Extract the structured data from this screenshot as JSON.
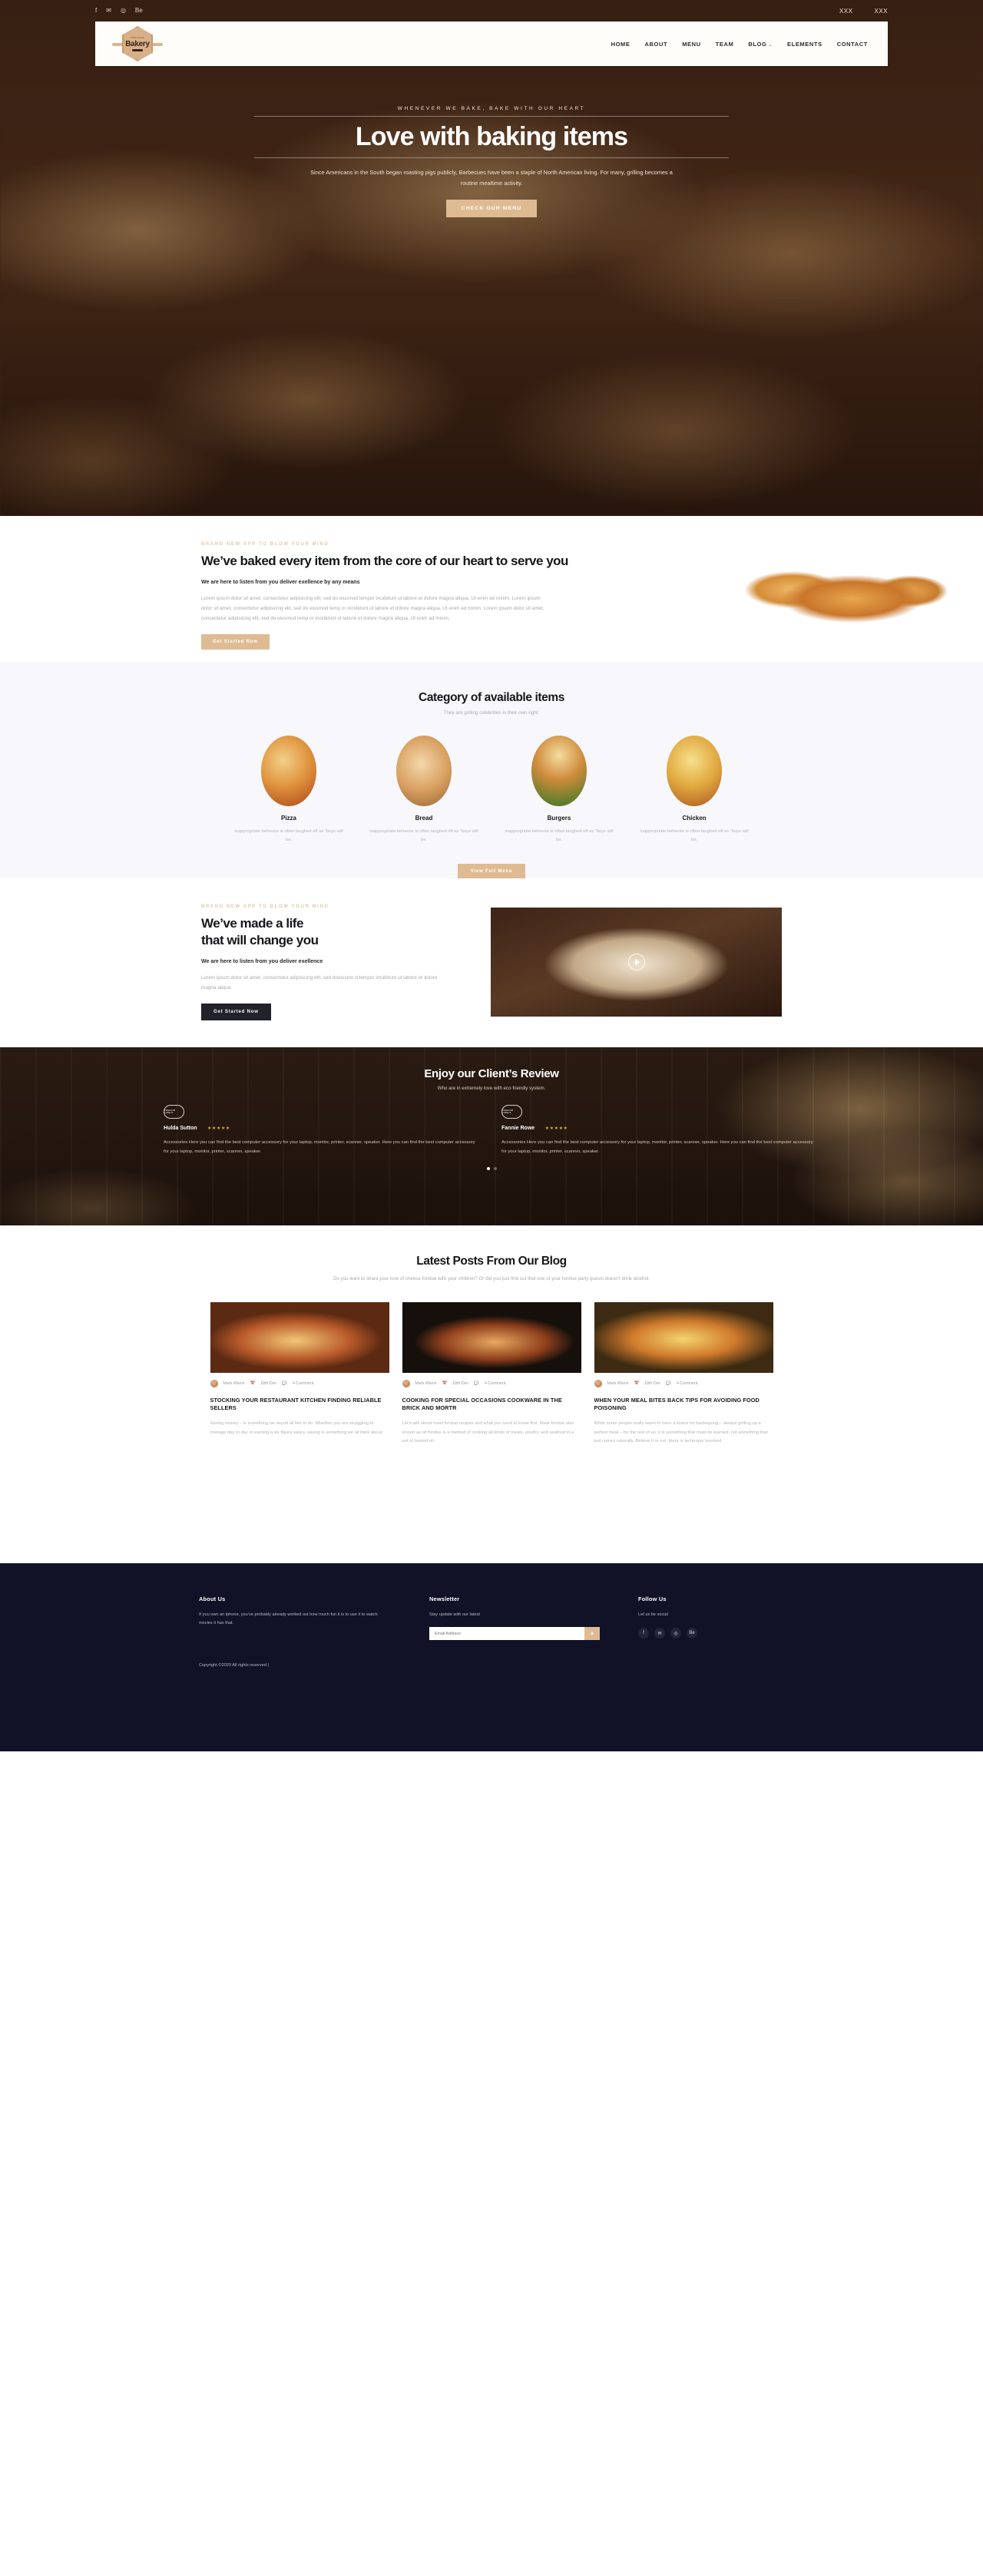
{
  "topbar": {
    "social": [
      "f",
      "✉",
      "◎",
      "Be"
    ],
    "right_items": [
      "XXX",
      "XXX"
    ]
  },
  "navbar": {
    "logo": {
      "top_text": "HAND MADE",
      "name": "Bakery"
    },
    "menu": [
      {
        "label": "HOME",
        "caret": ""
      },
      {
        "label": "ABOUT",
        "caret": ""
      },
      {
        "label": "MENU",
        "caret": ""
      },
      {
        "label": "TEAM",
        "caret": ""
      },
      {
        "label": "BLOG",
        "caret": "⌄"
      },
      {
        "label": "ELEMENTS",
        "caret": ""
      },
      {
        "label": "CONTACT",
        "caret": ""
      }
    ]
  },
  "hero": {
    "kicker": "WHENEVER WE BAKE, BAKE WITH OUR HEART",
    "title": "Love with baking items",
    "subtitle": "Since Americans in the South began roasting pigs publicly, Barbecues have been a staple of North American living. For many, grilling becomes a routine mealtime activity.",
    "cta": "CHECK OUR MENU"
  },
  "baked": {
    "kicker": "BRAND NEW APP TO BLOW YOUR MIND",
    "title": "We’ve baked every item from the core of our heart to serve you",
    "lead": "We are here to listen from you deliver exellence by any means",
    "paragraph": "Lorem ipsum dolor sit amet, consectetur adipisicing elit, sed do eiusmod tempor incididunt ut labore et dolore magna aliqua. Ut enim ad minim. Lorem ipsum dolor sit amet, consectetur adipisicing elit, sed do eiusmod temp or incididunt ut labore et dolore magna aliqua. Ut enim ad minim. Lorem ipsum dolor sit amet, consectetur adipisicing elit, sed do eiusmod temp or incididunt ut labore et dolore magna aliqua. Ut enim ad minim.",
    "cta": "Get Started Now"
  },
  "category": {
    "title": "Category of available items",
    "subtitle": "They are grilling celebrities in their own right.",
    "items": [
      {
        "name": "Pizza",
        "desc": "inappropriate behavior is often laughed off as “boys will be."
      },
      {
        "name": "Bread",
        "desc": "inappropriate behavior is often laughed off as “boys will be."
      },
      {
        "name": "Burgers",
        "desc": "inappropriate behavior is often laughed off as “boys will be."
      },
      {
        "name": "Chicken",
        "desc": "inappropriate behavior is often laughed off as “boys will be."
      }
    ],
    "cta": "View Full Menu"
  },
  "life": {
    "kicker": "BRAND NEW APP TO BLOW YOUR MIND",
    "title_line1": "We’ve made a life",
    "title_line2": "that will change you",
    "lead": "We are here to listen from you deliver exellence",
    "paragraph": "Lorem ipsum dolor sit amet, consectetur adipisicing elit, sed doeiusmo d tempor incididunt ut labore et dolore magna aliqua.",
    "cta": "Get Started Now"
  },
  "reviews": {
    "title": "Enjoy our Client’s Review",
    "subtitle": "Who are in extremely love with eco friendly system.",
    "badge_text": "PREMIUM LABELS",
    "cards": [
      {
        "name": "Hulda Sutton",
        "stars": "★★★★★",
        "text": "Accessories Here you can find the best computer accessory for your laptop, monitor, printer, scanner, speaker. Here you can find the best computer accessory for your laptop, monitor, printer, scanner, speaker."
      },
      {
        "name": "Fannie Rowe",
        "stars": "★★★★★",
        "text": "Accessories Here you can find the best computer accessory for your laptop, monitor, printer, scanner, speaker. Here you can find the best computer accessory for your laptop, monitor, printer, scanner, speaker."
      }
    ]
  },
  "blog": {
    "title": "Latest Posts From Our Blog",
    "subtitle": "Do you want to share your love of cheese fondue with your children? Or did you just find out that one of your fondue party guests doesn’t drink alcohol.",
    "posts": [
      {
        "author": "Mark Wiens",
        "date": "18th Dec",
        "comments": "4 Comment",
        "title": "STOCKING YOUR RESTAURANT KITCHEN FINDING RELIABLE SELLERS",
        "excerpt": "Saving money – is something we would all like to do. Whether you are struggling to manage day to day or earning a six figure salary, saving is something we all think about."
      },
      {
        "author": "Mark Wiens",
        "date": "18th Dec",
        "comments": "4 Comment",
        "title": "COOKING FOR SPECIAL OCCASIONS COOKWARE IN THE BRICK AND MORTR",
        "excerpt": "Let’s talk about meat fondue recipes and what you need to know first. Meat fondue also known as oil fondue is a method of cooking all kinds of meats, poultry, and seafood in a pot of heated oil."
      },
      {
        "author": "Mark Wiens",
        "date": "18th Dec",
        "comments": "4 Comment",
        "title": "WHEN YOUR MEAL BITES BACK TIPS FOR AVOIDING FOOD POISONING",
        "excerpt": "While some people really seem to have a knack for barbequing – always grilling up a perfect meal – for the rest of us, it is something that must be learned, not something that just comes naturally. Believe it or not, there is technique involved."
      }
    ]
  },
  "footer": {
    "about": {
      "heading": "About Us",
      "text": "If you own an iphone, you’ve probably already worked out how much fun it is to use it to watch movies it has that."
    },
    "newsletter": {
      "heading": "Newsletter",
      "text": "Stay update with our latest",
      "placeholder": "Email Address",
      "button": "✈"
    },
    "follow": {
      "heading": "Follow Us",
      "text": "Let us be social",
      "icons": [
        "f",
        "✉",
        "◎",
        "Be"
      ]
    },
    "copyright": "Copyright ©2020 All rights reserved |"
  }
}
